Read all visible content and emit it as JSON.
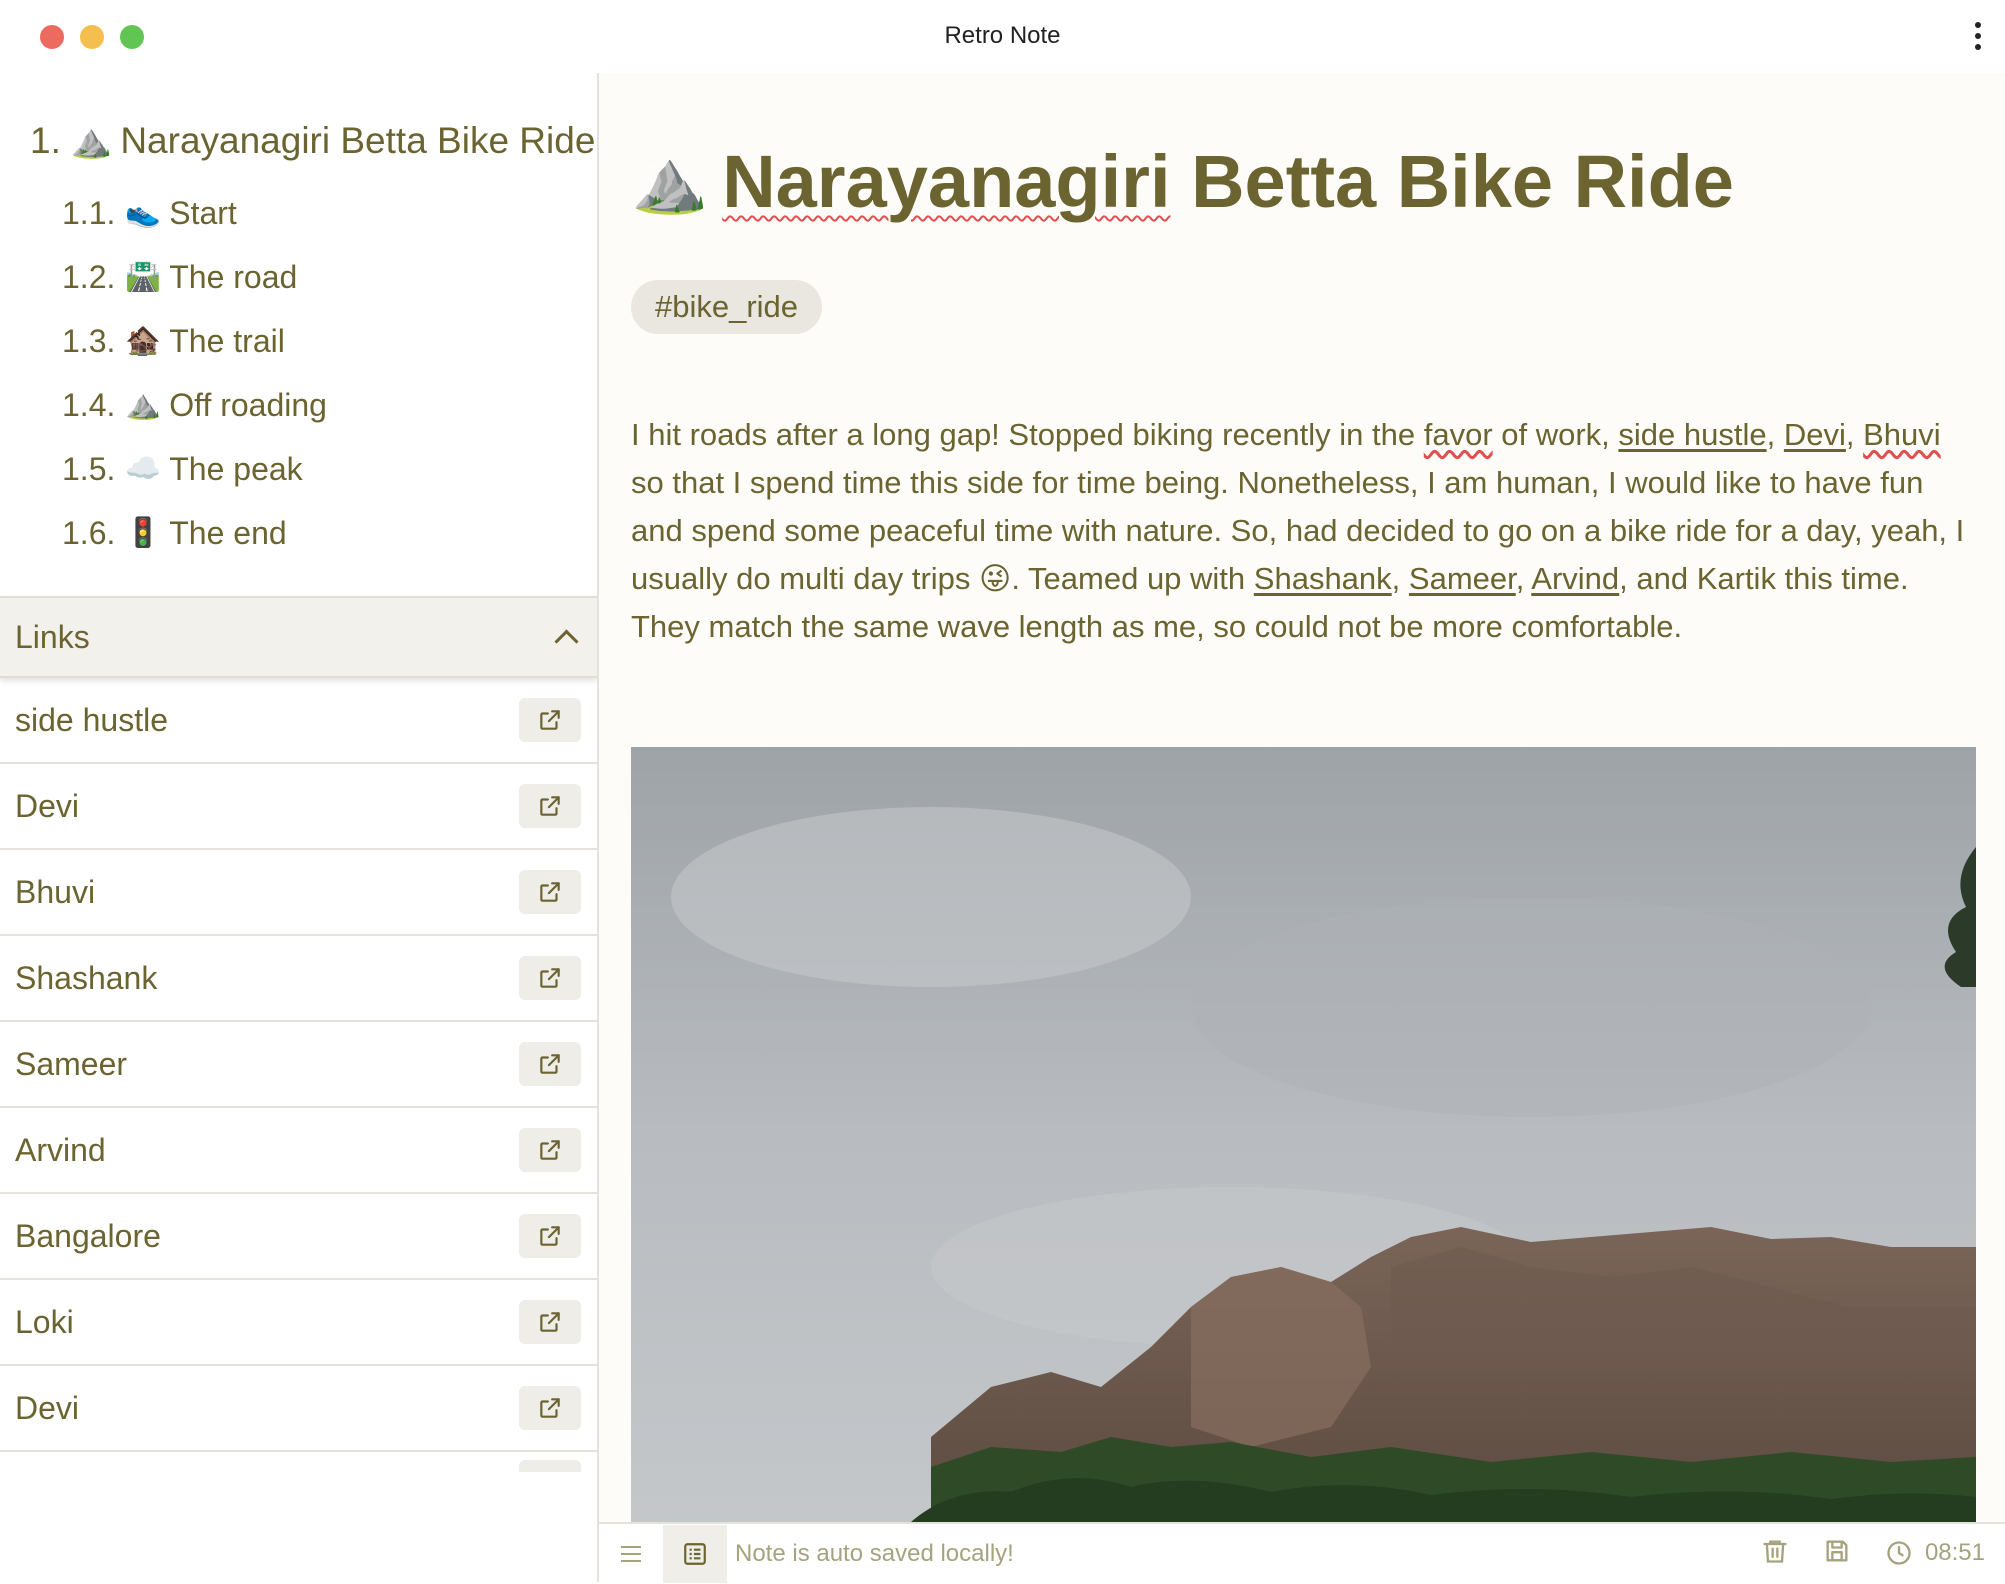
{
  "window": {
    "title": "Retro Note"
  },
  "toc": {
    "h1": {
      "num": "1.",
      "emoji": "⛰️",
      "label": "Narayanagiri Betta Bike Ride"
    },
    "items": [
      {
        "num": "1.1.",
        "emoji": "👟",
        "label": "Start"
      },
      {
        "num": "1.2.",
        "emoji": "🛣️",
        "label": "The road"
      },
      {
        "num": "1.3.",
        "emoji": "🏚️",
        "label": "The trail"
      },
      {
        "num": "1.4.",
        "emoji": "⛰️",
        "label": "Off roading"
      },
      {
        "num": "1.5.",
        "emoji": "☁️",
        "label": "The peak"
      },
      {
        "num": "1.6.",
        "emoji": "🚦",
        "label": "The end"
      }
    ]
  },
  "links": {
    "header": "Links",
    "items": [
      "side hustle",
      "Devi",
      "Bhuvi",
      "Shashank",
      "Sameer",
      "Arvind",
      "Bangalore",
      "Loki",
      "Devi"
    ]
  },
  "note": {
    "title_emoji": "⛰️",
    "title_word1": "Narayanagiri",
    "title_rest": " Betta Bike Ride",
    "tag": "#bike_ride",
    "p": {
      "t1": "I hit roads after a long gap! Stopped biking recently in the ",
      "favor": "favor",
      "t2": " of work, ",
      "l_side_hustle": "side hustle",
      "c1": ", ",
      "l_devi": "Devi",
      "c2": ", ",
      "l_bhuvi": "Bhuvi",
      "t3": " so that I spend time this side for time being. Nonetheless, I am human, I would like to have fun and spend some peaceful time with nature. So, had decided to go on a bike ride for a day, yeah, I usually do multi day trips ",
      "emoji": "😜",
      "t4": ". Teamed up with ",
      "l_shashank": "Shashank",
      "c3": ", ",
      "l_sameer": "Sameer",
      "c4": ", ",
      "l_arvind": "Arvind",
      "t5": ", and Kartik this time. They match the same wave length as me, so could not be more comfortable."
    }
  },
  "status": {
    "message": "Note is auto saved locally!",
    "time": "08:51"
  },
  "colors": {
    "accent_text": "#6b6330",
    "muted_text": "#a7a27e",
    "note_bg": "#fdfcf8",
    "tag_bg": "#e9e7df"
  }
}
